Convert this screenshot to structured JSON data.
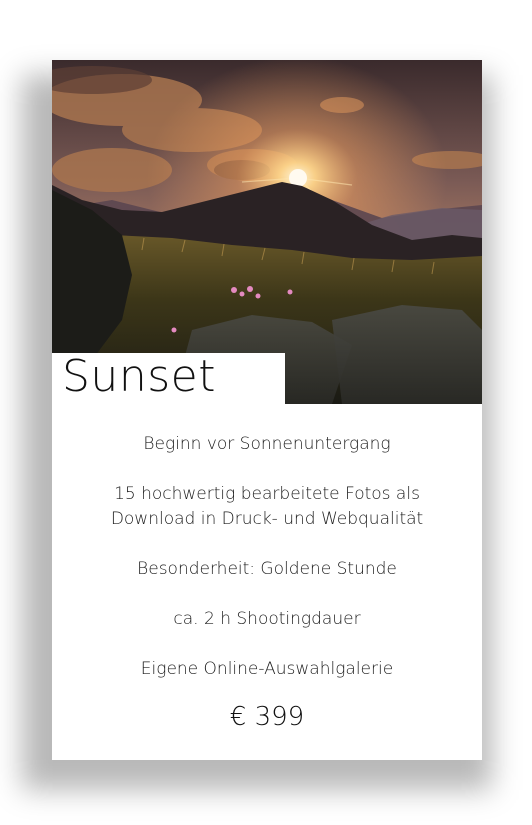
{
  "package": {
    "title": "Sunset",
    "image_alt": "sunset over mountain meadow",
    "features": [
      "Beginn vor Sonnenuntergang",
      "15 hochwertig bearbeitete Fotos als\nDownload in Druck- und Webqualität",
      "Besonderheit: Goldene Stunde",
      "ca. 2 h Shootingdauer",
      "Eigene Online-Auswahlgalerie"
    ],
    "price": "€ 399"
  }
}
